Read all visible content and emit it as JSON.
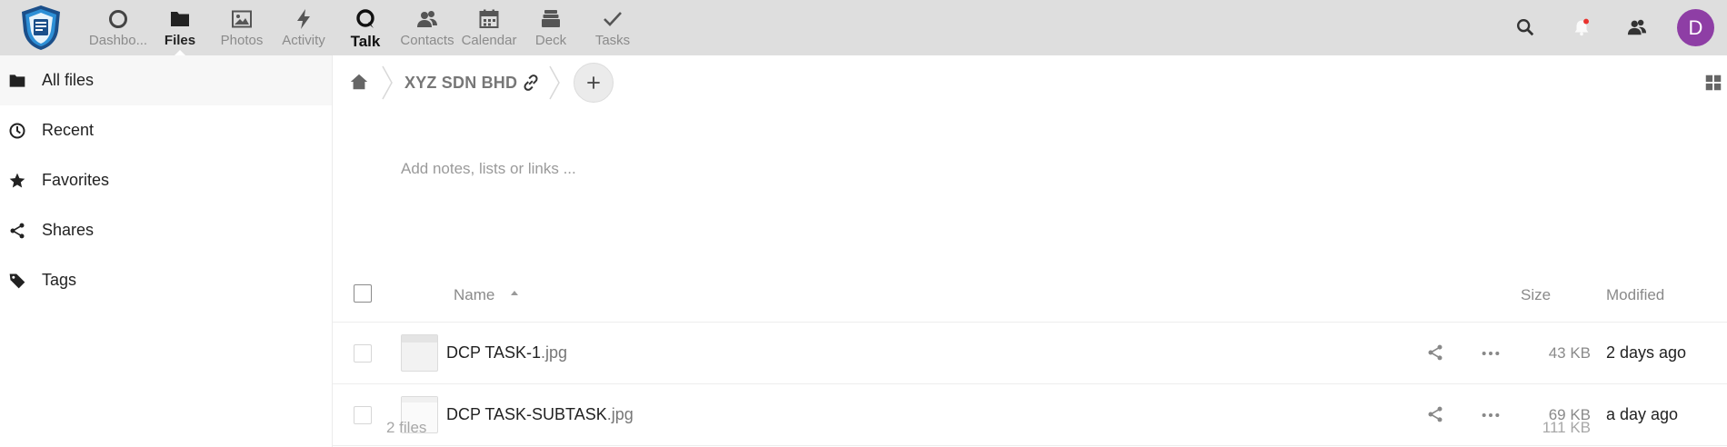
{
  "header": {
    "apps": [
      {
        "id": "dashboard",
        "label": "Dashbo...",
        "icon": "dashboard-icon",
        "active": false
      },
      {
        "id": "files",
        "label": "Files",
        "icon": "folder-icon",
        "active": true
      },
      {
        "id": "photos",
        "label": "Photos",
        "icon": "image-icon",
        "active": false
      },
      {
        "id": "activity",
        "label": "Activity",
        "icon": "lightning-icon",
        "active": false
      },
      {
        "id": "talk",
        "label": "Talk",
        "icon": "talk-icon",
        "active": false
      },
      {
        "id": "contacts",
        "label": "Contacts",
        "icon": "contacts-icon",
        "active": false
      },
      {
        "id": "calendar",
        "label": "Calendar",
        "icon": "calendar-icon",
        "active": false
      },
      {
        "id": "deck",
        "label": "Deck",
        "icon": "deck-icon",
        "active": false
      },
      {
        "id": "tasks",
        "label": "Tasks",
        "icon": "checkmark-icon",
        "active": false
      }
    ],
    "avatar_initial": "D",
    "avatar_color": "#8e3ea5"
  },
  "sidebar": {
    "items": [
      {
        "label": "All files",
        "icon": "folder-icon",
        "active": true
      },
      {
        "label": "Recent",
        "icon": "clock-icon",
        "active": false
      },
      {
        "label": "Favorites",
        "icon": "star-icon",
        "active": false
      },
      {
        "label": "Shares",
        "icon": "share-icon",
        "active": false
      },
      {
        "label": "Tags",
        "icon": "tag-icon",
        "active": false
      }
    ]
  },
  "breadcrumb": {
    "folder": "XYZ SDN BHD"
  },
  "notes": {
    "placeholder": "Add notes, lists or links ..."
  },
  "table": {
    "columns": {
      "name": "Name",
      "size": "Size",
      "modified": "Modified"
    },
    "rows": [
      {
        "base": "DCP TASK-1",
        "ext": ".jpg",
        "size": "43 KB",
        "modified": "2 days ago"
      },
      {
        "base": "DCP TASK-SUBTASK",
        "ext": ".jpg",
        "size": "69 KB",
        "modified": "a day ago"
      }
    ],
    "summary": {
      "count": "2 files",
      "size": "111 KB"
    }
  },
  "colors": {
    "header_bg": "#dedede",
    "notification_dot": "#e9322d"
  }
}
